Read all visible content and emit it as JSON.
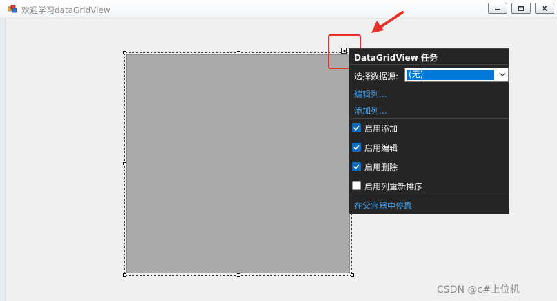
{
  "window": {
    "title": "欢迎学习dataGridView",
    "title_color": "#8c8c8c"
  },
  "grid": {
    "fill_color": "#ababab"
  },
  "annotation": {
    "color": "#e6322b"
  },
  "tasks_panel": {
    "title": "DataGridView 任务",
    "data_source_label": "选择数据源:",
    "data_source_value": "(无)",
    "edit_columns_link": "编辑列...",
    "add_column_link": "添加列...",
    "options": [
      {
        "label": "启用添加",
        "checked": true
      },
      {
        "label": "启用编辑",
        "checked": true
      },
      {
        "label": "启用删除",
        "checked": true
      },
      {
        "label": "启用列重新排序",
        "checked": false
      }
    ],
    "dock_link": "在父容器中停靠",
    "background": "#252526",
    "link_color": "#3ea0ef",
    "accent": "#0078d7"
  },
  "watermark": "CSDN @c#上位机"
}
